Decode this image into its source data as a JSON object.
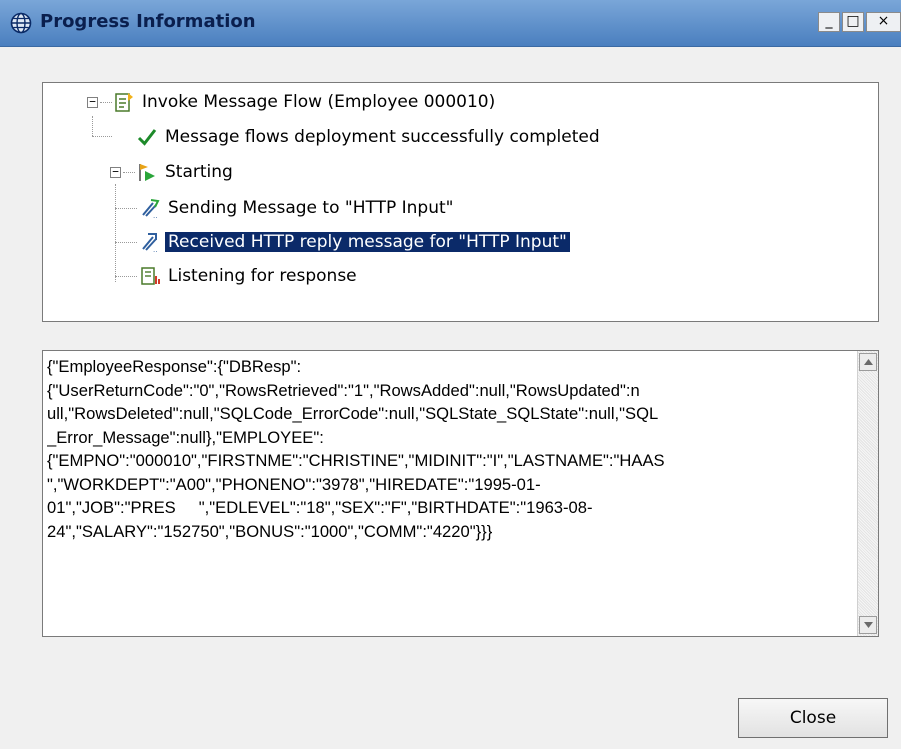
{
  "window": {
    "title": "Progress Information",
    "controls": {
      "minimize": "_",
      "maximize": "□",
      "close": "×"
    }
  },
  "tree": {
    "root": {
      "label": "Invoke Message Flow (Employee 000010)",
      "icon": "flow-icon"
    },
    "items": [
      {
        "label": "Message flows deployment successfully completed",
        "icon": "checkmark-icon"
      },
      {
        "label": "Starting",
        "icon": "starting-icon"
      },
      {
        "label": "Sending Message to \"HTTP Input\"",
        "icon": "send-message-icon"
      },
      {
        "label": "Received HTTP reply message for \"HTTP Input\"",
        "icon": "receive-message-icon",
        "selected": true
      },
      {
        "label": "Listening for response",
        "icon": "listening-icon"
      }
    ]
  },
  "response_text": "{\"EmployeeResponse\":{\"DBResp\":\n{\"UserReturnCode\":\"0\",\"RowsRetrieved\":\"1\",\"RowsAdded\":null,\"RowsUpdated\":n\null,\"RowsDeleted\":null,\"SQLCode_ErrorCode\":null,\"SQLState_SQLState\":null,\"SQL\n_Error_Message\":null},\"EMPLOYEE\":\n{\"EMPNO\":\"000010\",\"FIRSTNME\":\"CHRISTINE\",\"MIDINIT\":\"I\",\"LASTNAME\":\"HAAS\n\",\"WORKDEPT\":\"A00\",\"PHONENO\":\"3978\",\"HIREDATE\":\"1995-01-\n01\",\"JOB\":\"PRES     \",\"EDLEVEL\":\"18\",\"SEX\":\"F\",\"BIRTHDATE\":\"1963-08-\n24\",\"SALARY\":\"152750\",\"BONUS\":\"1000\",\"COMM\":\"4220\"}}}",
  "buttons": {
    "close": "Close"
  }
}
